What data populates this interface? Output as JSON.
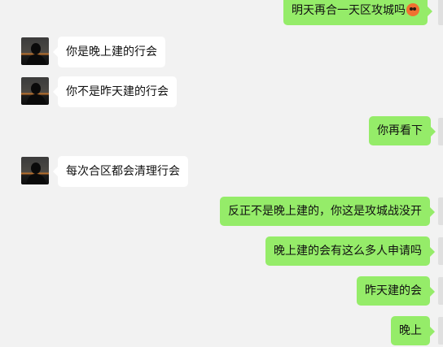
{
  "conversation": {
    "messages": [
      {
        "side": "out",
        "text": "明天再合一天区攻城吗",
        "emoji": "angry-face-icon"
      },
      {
        "side": "in",
        "text": "你是晚上建的行会"
      },
      {
        "side": "in",
        "text": "你不是昨天建的行会"
      },
      {
        "side": "out",
        "text": "你再看下"
      },
      {
        "side": "in",
        "text": "每次合区都会清理行会"
      },
      {
        "side": "out",
        "text": "反正不是晚上建的，你这是攻城战没开"
      },
      {
        "side": "out",
        "text": "晚上建的会有这么多人申请吗"
      },
      {
        "side": "out",
        "text": "昨天建的会"
      },
      {
        "side": "out",
        "text": "晚上"
      }
    ]
  },
  "colors": {
    "background": "#f2f2f2",
    "outgoing_bubble": "#95ec69",
    "incoming_bubble": "#ffffff"
  }
}
